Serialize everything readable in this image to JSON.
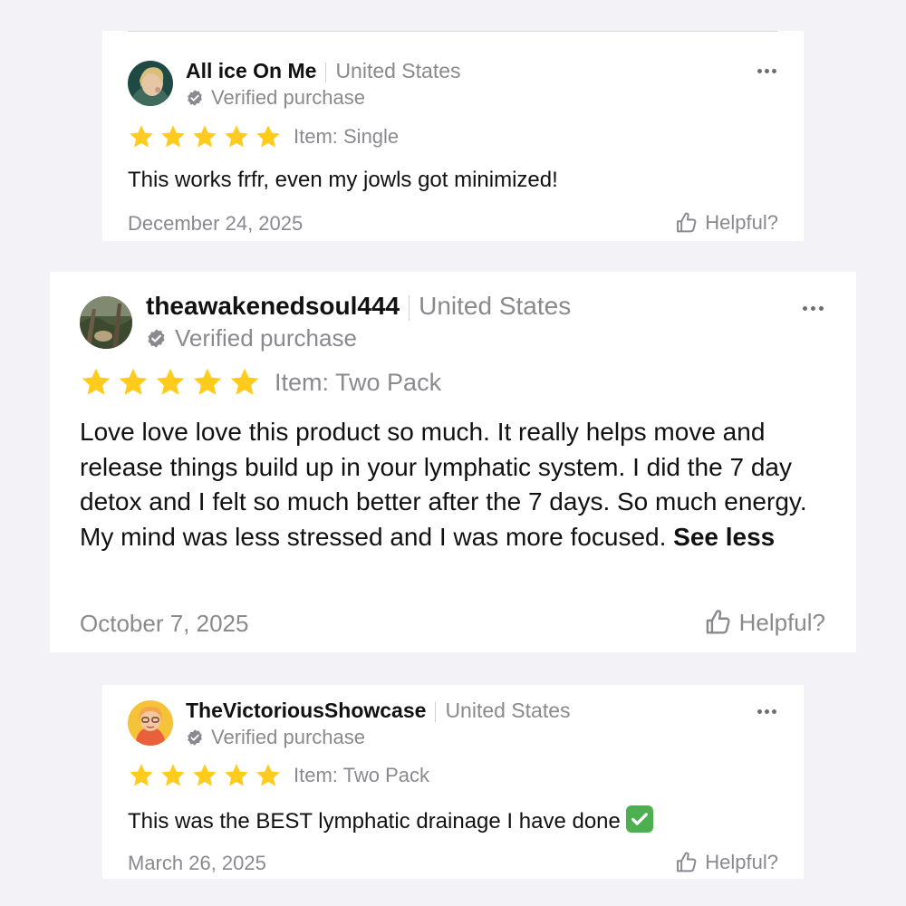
{
  "colors": {
    "page_background": "#f2f2f7",
    "card_background": "#ffffff",
    "star": "#ffcc1d",
    "muted_text": "#8a8a8e",
    "verified_badge": "#8a8a8e",
    "check_emoji": "#4caf50"
  },
  "reviews": [
    {
      "author": "All ice On Me",
      "country": "United States",
      "verified": "Verified purchase",
      "rating": 5,
      "variant": "Item: Single",
      "text": "This works frfr, even my jowls got minimized!",
      "date": "December 24, 2025",
      "helpful": "Helpful?",
      "avatar_icon": "user-photo-avatar",
      "more_icon": "more-horizontal-icon"
    },
    {
      "author": "theawakenedsoul444",
      "country": "United States",
      "verified": "Verified purchase",
      "rating": 5,
      "variant": "Item: Two Pack",
      "text": "Love love love this product so much. It really helps move and release things build up in your lymphatic system. I did the 7 day detox and I felt so much better after the 7 days. So much energy. My mind was less stressed and I was more focused.",
      "see_less": "See less",
      "date": "October 7, 2025",
      "helpful": "Helpful?",
      "avatar_icon": "nature-photo-avatar",
      "more_icon": "more-horizontal-icon"
    },
    {
      "author": "TheVictoriousShowcase",
      "country": "United States",
      "verified": "Verified purchase",
      "rating": 5,
      "variant": "Item: Two Pack",
      "text": "This was the BEST lymphatic drainage I have done",
      "emoji": "check-mark-button-emoji",
      "date": "March 26, 2025",
      "helpful": "Helpful?",
      "avatar_icon": "cartoon-avatar",
      "more_icon": "more-horizontal-icon"
    }
  ]
}
